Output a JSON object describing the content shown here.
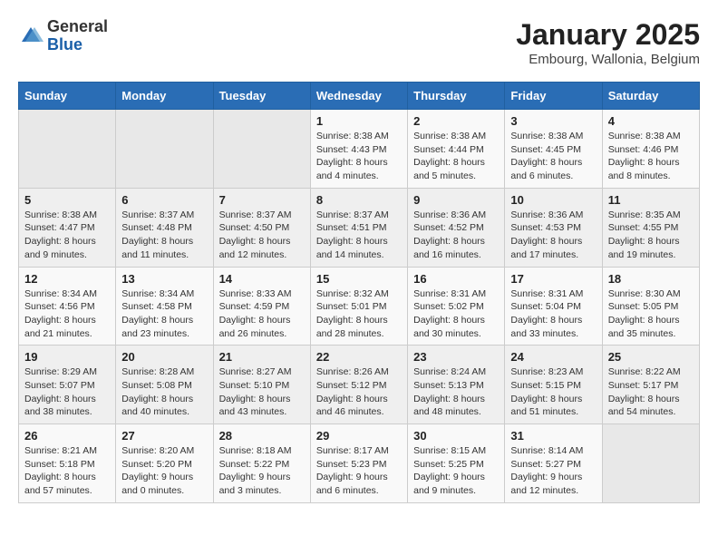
{
  "logo": {
    "general": "General",
    "blue": "Blue"
  },
  "header": {
    "title": "January 2025",
    "subtitle": "Embourg, Wallonia, Belgium"
  },
  "weekdays": [
    "Sunday",
    "Monday",
    "Tuesday",
    "Wednesday",
    "Thursday",
    "Friday",
    "Saturday"
  ],
  "weeks": [
    [
      {
        "day": "",
        "info": ""
      },
      {
        "day": "",
        "info": ""
      },
      {
        "day": "",
        "info": ""
      },
      {
        "day": "1",
        "info": "Sunrise: 8:38 AM\nSunset: 4:43 PM\nDaylight: 8 hours\nand 4 minutes."
      },
      {
        "day": "2",
        "info": "Sunrise: 8:38 AM\nSunset: 4:44 PM\nDaylight: 8 hours\nand 5 minutes."
      },
      {
        "day": "3",
        "info": "Sunrise: 8:38 AM\nSunset: 4:45 PM\nDaylight: 8 hours\nand 6 minutes."
      },
      {
        "day": "4",
        "info": "Sunrise: 8:38 AM\nSunset: 4:46 PM\nDaylight: 8 hours\nand 8 minutes."
      }
    ],
    [
      {
        "day": "5",
        "info": "Sunrise: 8:38 AM\nSunset: 4:47 PM\nDaylight: 8 hours\nand 9 minutes."
      },
      {
        "day": "6",
        "info": "Sunrise: 8:37 AM\nSunset: 4:48 PM\nDaylight: 8 hours\nand 11 minutes."
      },
      {
        "day": "7",
        "info": "Sunrise: 8:37 AM\nSunset: 4:50 PM\nDaylight: 8 hours\nand 12 minutes."
      },
      {
        "day": "8",
        "info": "Sunrise: 8:37 AM\nSunset: 4:51 PM\nDaylight: 8 hours\nand 14 minutes."
      },
      {
        "day": "9",
        "info": "Sunrise: 8:36 AM\nSunset: 4:52 PM\nDaylight: 8 hours\nand 16 minutes."
      },
      {
        "day": "10",
        "info": "Sunrise: 8:36 AM\nSunset: 4:53 PM\nDaylight: 8 hours\nand 17 minutes."
      },
      {
        "day": "11",
        "info": "Sunrise: 8:35 AM\nSunset: 4:55 PM\nDaylight: 8 hours\nand 19 minutes."
      }
    ],
    [
      {
        "day": "12",
        "info": "Sunrise: 8:34 AM\nSunset: 4:56 PM\nDaylight: 8 hours\nand 21 minutes."
      },
      {
        "day": "13",
        "info": "Sunrise: 8:34 AM\nSunset: 4:58 PM\nDaylight: 8 hours\nand 23 minutes."
      },
      {
        "day": "14",
        "info": "Sunrise: 8:33 AM\nSunset: 4:59 PM\nDaylight: 8 hours\nand 26 minutes."
      },
      {
        "day": "15",
        "info": "Sunrise: 8:32 AM\nSunset: 5:01 PM\nDaylight: 8 hours\nand 28 minutes."
      },
      {
        "day": "16",
        "info": "Sunrise: 8:31 AM\nSunset: 5:02 PM\nDaylight: 8 hours\nand 30 minutes."
      },
      {
        "day": "17",
        "info": "Sunrise: 8:31 AM\nSunset: 5:04 PM\nDaylight: 8 hours\nand 33 minutes."
      },
      {
        "day": "18",
        "info": "Sunrise: 8:30 AM\nSunset: 5:05 PM\nDaylight: 8 hours\nand 35 minutes."
      }
    ],
    [
      {
        "day": "19",
        "info": "Sunrise: 8:29 AM\nSunset: 5:07 PM\nDaylight: 8 hours\nand 38 minutes."
      },
      {
        "day": "20",
        "info": "Sunrise: 8:28 AM\nSunset: 5:08 PM\nDaylight: 8 hours\nand 40 minutes."
      },
      {
        "day": "21",
        "info": "Sunrise: 8:27 AM\nSunset: 5:10 PM\nDaylight: 8 hours\nand 43 minutes."
      },
      {
        "day": "22",
        "info": "Sunrise: 8:26 AM\nSunset: 5:12 PM\nDaylight: 8 hours\nand 46 minutes."
      },
      {
        "day": "23",
        "info": "Sunrise: 8:24 AM\nSunset: 5:13 PM\nDaylight: 8 hours\nand 48 minutes."
      },
      {
        "day": "24",
        "info": "Sunrise: 8:23 AM\nSunset: 5:15 PM\nDaylight: 8 hours\nand 51 minutes."
      },
      {
        "day": "25",
        "info": "Sunrise: 8:22 AM\nSunset: 5:17 PM\nDaylight: 8 hours\nand 54 minutes."
      }
    ],
    [
      {
        "day": "26",
        "info": "Sunrise: 8:21 AM\nSunset: 5:18 PM\nDaylight: 8 hours\nand 57 minutes."
      },
      {
        "day": "27",
        "info": "Sunrise: 8:20 AM\nSunset: 5:20 PM\nDaylight: 9 hours\nand 0 minutes."
      },
      {
        "day": "28",
        "info": "Sunrise: 8:18 AM\nSunset: 5:22 PM\nDaylight: 9 hours\nand 3 minutes."
      },
      {
        "day": "29",
        "info": "Sunrise: 8:17 AM\nSunset: 5:23 PM\nDaylight: 9 hours\nand 6 minutes."
      },
      {
        "day": "30",
        "info": "Sunrise: 8:15 AM\nSunset: 5:25 PM\nDaylight: 9 hours\nand 9 minutes."
      },
      {
        "day": "31",
        "info": "Sunrise: 8:14 AM\nSunset: 5:27 PM\nDaylight: 9 hours\nand 12 minutes."
      },
      {
        "day": "",
        "info": ""
      }
    ]
  ]
}
